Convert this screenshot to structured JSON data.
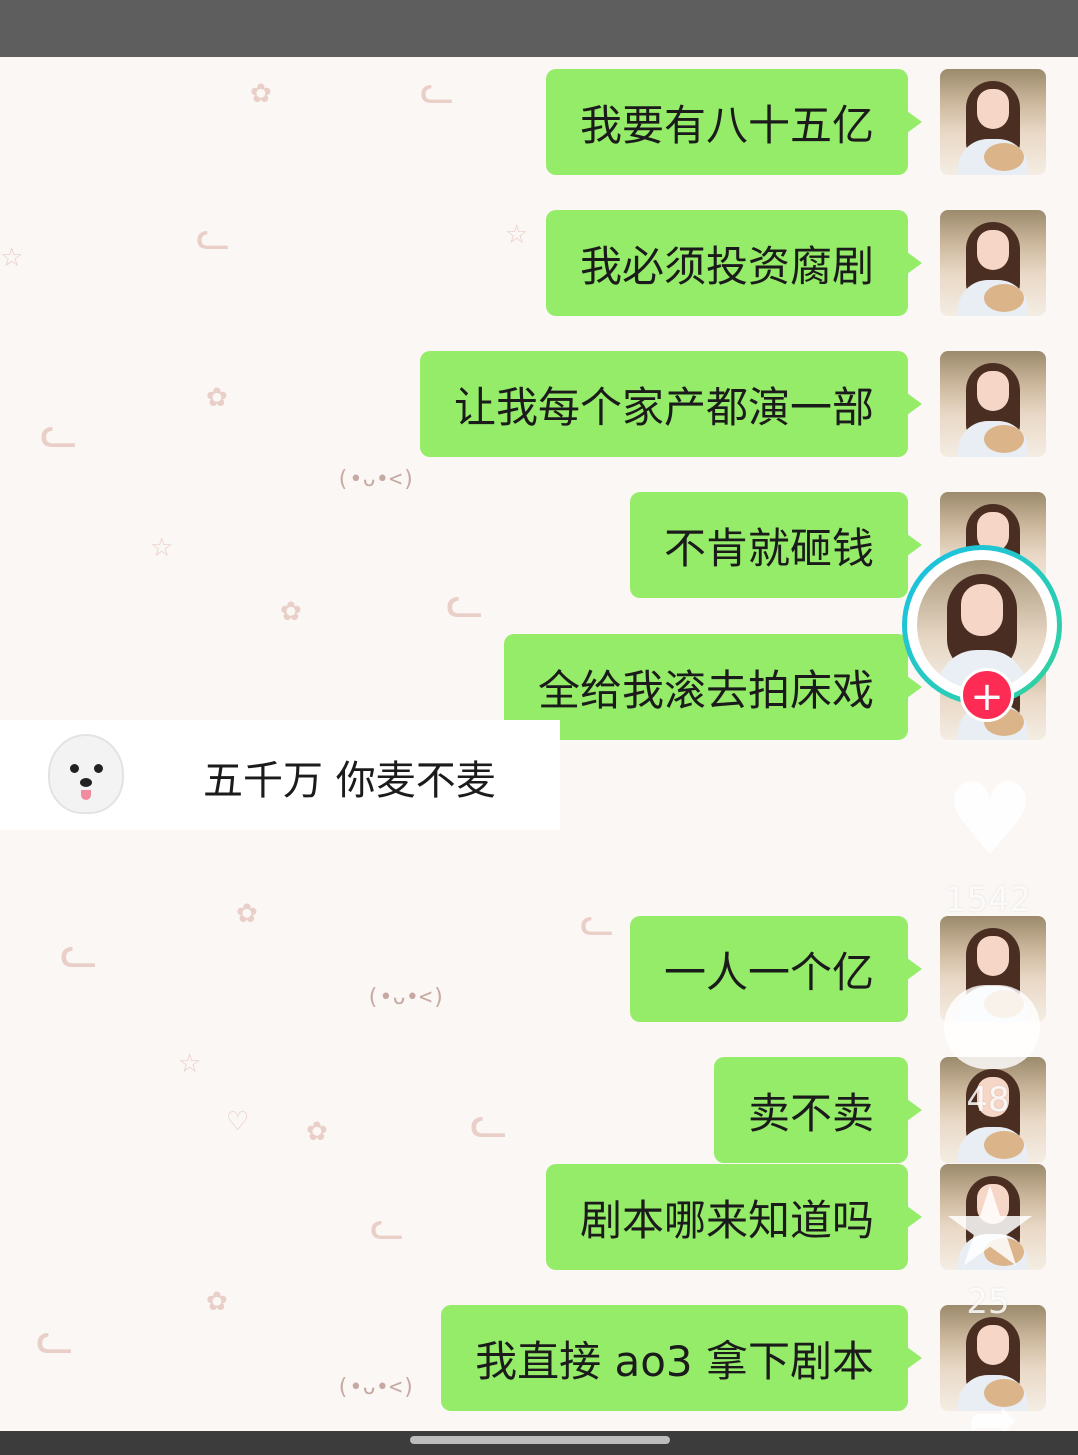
{
  "messages_sent_top": [
    {
      "text": "我要有八十五亿"
    },
    {
      "text": "我必须投资腐剧"
    },
    {
      "text": "让我每个家产都演一部"
    },
    {
      "text": "不肯就砸钱"
    },
    {
      "text": "全给我滚去拍床戏"
    }
  ],
  "message_received": {
    "text": "五千万 你麦不麦"
  },
  "messages_sent_bottom": [
    {
      "text": "一人一个亿"
    },
    {
      "text": "卖不卖"
    },
    {
      "text": "剧本哪来知道吗"
    },
    {
      "text": "我直接 ao3 拿下剧本"
    }
  ],
  "overlay": {
    "follow_label": "+",
    "like_count": "1542",
    "comment_count": "48",
    "favorite_count": "25"
  },
  "decor": {
    "kaomoji": "(•ᴗ•<)",
    "icons": [
      "bunny-sticker-icon",
      "flower-icon",
      "star-icon",
      "heart-icon"
    ]
  },
  "colors": {
    "sent_bubble": "#95ec69",
    "follow_button": "#fe2c55",
    "live_ring": "#19c0e8"
  }
}
